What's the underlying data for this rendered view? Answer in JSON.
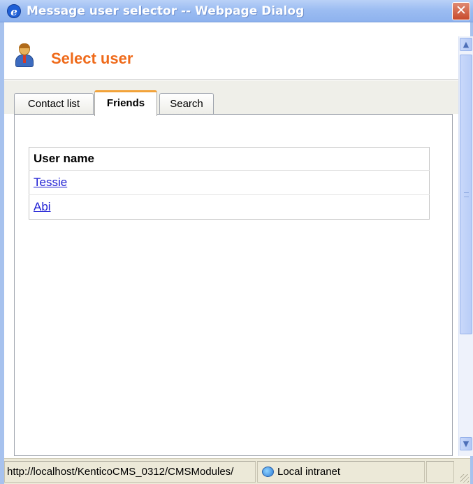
{
  "window": {
    "title": "Message user selector -- Webpage Dialog",
    "close_label": "✕"
  },
  "header": {
    "title": "Select user"
  },
  "tabs": [
    {
      "label": "Contact list",
      "active": false
    },
    {
      "label": "Friends",
      "active": true
    },
    {
      "label": "Search",
      "active": false
    }
  ],
  "table": {
    "header": "User name",
    "rows": [
      "Tessie",
      "Abi"
    ]
  },
  "statusbar": {
    "url": "http://localhost/KenticoCMS_0312/CMSModules/",
    "zone": "Local intranet"
  },
  "colors": {
    "title_accent": "#ef6a1a",
    "active_tab_border": "#f2a33a",
    "link": "#1d1dd4",
    "titlebar": "#9cbdf2"
  },
  "icons": {
    "window": "ie-icon",
    "header": "user-icon",
    "zone": "local-intranet-icon"
  }
}
